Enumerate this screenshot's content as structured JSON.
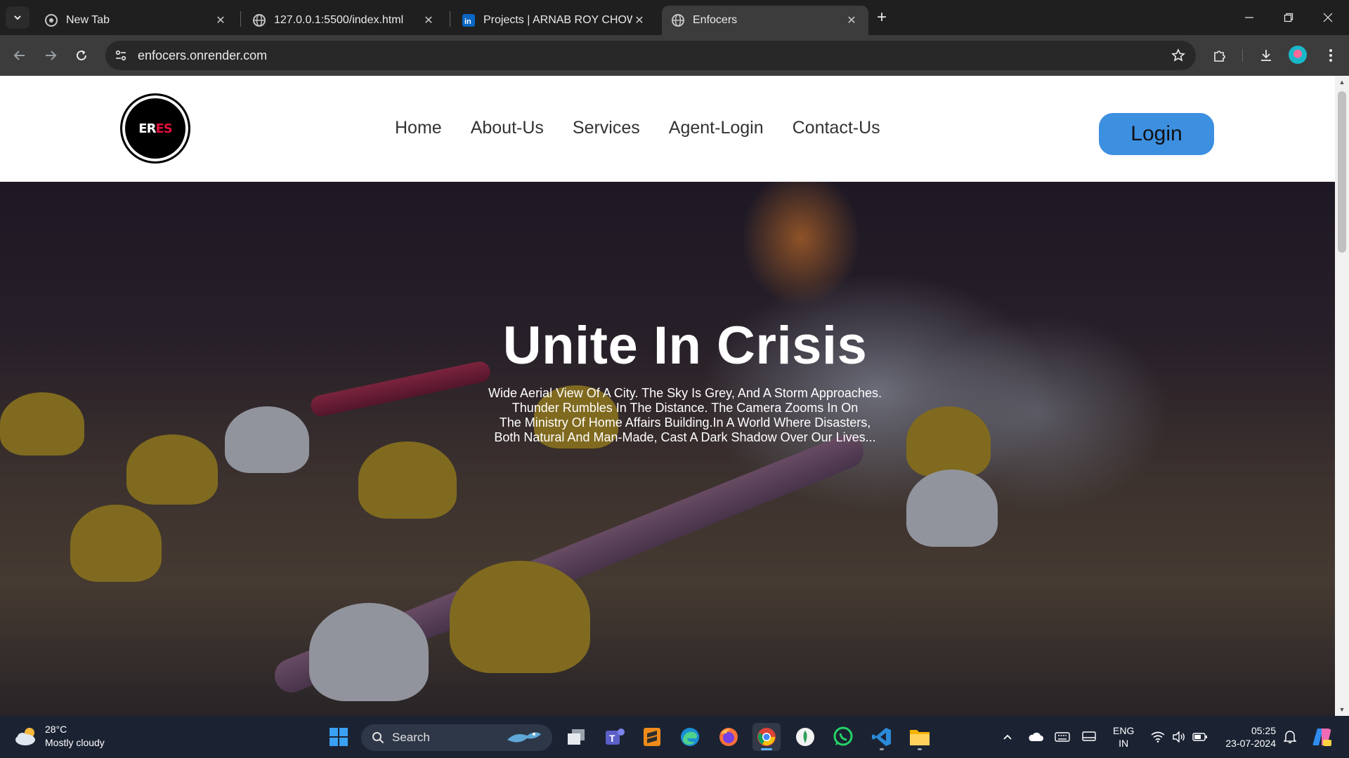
{
  "browser": {
    "tabs": [
      {
        "title": "New Tab",
        "icon": "chrome-icon",
        "active": false
      },
      {
        "title": "127.0.0.1:5500/index.html",
        "icon": "globe-icon",
        "active": false
      },
      {
        "title": "Projects | ARNAB ROY CHOWDHURY",
        "icon": "linkedin-icon",
        "active": false
      },
      {
        "title": "Enfocers",
        "icon": "globe-icon",
        "active": true
      }
    ],
    "url": "enfocers.onrender.com"
  },
  "site": {
    "logo_text_left": "ER",
    "logo_text_right": "ES",
    "nav": [
      "Home",
      "About-Us",
      "Services",
      "Agent-Login",
      "Contact-Us"
    ],
    "login_label": "Login",
    "hero": {
      "title": "Unite In Crisis",
      "lines": [
        "Wide Aerial View Of A City. The Sky Is Grey, And A Storm Approaches.",
        "Thunder Rumbles In The Distance. The Camera Zooms In On",
        "The Ministry Of Home Affairs Building.In A World Where Disasters,",
        "Both Natural And Man-Made, Cast A Dark Shadow Over Our Lives..."
      ]
    }
  },
  "taskbar": {
    "weather_temp": "28°C",
    "weather_desc": "Mostly cloudy",
    "search_placeholder": "Search",
    "lang_line1": "ENG",
    "lang_line2": "IN",
    "time": "05:25",
    "date": "23-07-2024"
  },
  "colors": {
    "login_button": "#3d8fe0",
    "chrome_dark": "#1f1f1f",
    "taskbar": "#1b2333"
  }
}
